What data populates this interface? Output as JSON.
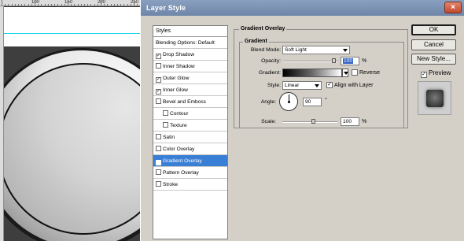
{
  "ruler": {
    "numbers": [
      "100",
      "150",
      "200",
      "250"
    ]
  },
  "dialog": {
    "title": "Layer Style",
    "close_glyph": "×"
  },
  "styles_panel": {
    "header": "Styles",
    "items": [
      {
        "label": "Blending Options: Default",
        "checkbox": false,
        "checked": false,
        "selected": false,
        "indent": false
      },
      {
        "label": "Drop Shadow",
        "checkbox": true,
        "checked": true,
        "selected": false,
        "indent": false
      },
      {
        "label": "Inner Shadow",
        "checkbox": true,
        "checked": false,
        "selected": false,
        "indent": false
      },
      {
        "label": "Outer Glow",
        "checkbox": true,
        "checked": true,
        "selected": false,
        "indent": false
      },
      {
        "label": "Inner Glow",
        "checkbox": true,
        "checked": true,
        "selected": false,
        "indent": false
      },
      {
        "label": "Bevel and Emboss",
        "checkbox": true,
        "checked": false,
        "selected": false,
        "indent": false
      },
      {
        "label": "Contour",
        "checkbox": true,
        "checked": false,
        "selected": false,
        "indent": true
      },
      {
        "label": "Texture",
        "checkbox": true,
        "checked": false,
        "selected": false,
        "indent": true
      },
      {
        "label": "Satin",
        "checkbox": true,
        "checked": false,
        "selected": false,
        "indent": false
      },
      {
        "label": "Color Overlay",
        "checkbox": true,
        "checked": false,
        "selected": false,
        "indent": false
      },
      {
        "label": "Gradient Overlay",
        "checkbox": true,
        "checked": true,
        "selected": true,
        "indent": false
      },
      {
        "label": "Pattern Overlay",
        "checkbox": true,
        "checked": false,
        "selected": false,
        "indent": false
      },
      {
        "label": "Stroke",
        "checkbox": true,
        "checked": false,
        "selected": false,
        "indent": false
      }
    ]
  },
  "gradient_overlay": {
    "section_title": "Gradient Overlay",
    "group_title": "Gradient",
    "blend_mode_label": "Blend Mode:",
    "blend_mode_value": "Soft Light",
    "opacity_label": "Opacity:",
    "opacity_value": "100",
    "opacity_unit": "%",
    "gradient_label": "Gradient:",
    "reverse_label": "Reverse",
    "reverse_checked": false,
    "style_label": "Style:",
    "style_value": "Linear",
    "align_label": "Align with Layer",
    "align_checked": true,
    "angle_label": "Angle:",
    "angle_value": "90",
    "angle_unit": "°",
    "scale_label": "Scale:",
    "scale_value": "100",
    "scale_unit": "%"
  },
  "buttons": {
    "ok": "OK",
    "cancel": "Cancel",
    "new_style": "New Style..."
  },
  "preview": {
    "label": "Preview",
    "checked": true
  },
  "colors": {
    "selection": "#3a7fd6",
    "titlebar": "#7a91b4",
    "close": "#c24a2f",
    "dialog_bg": "#d4d0c8"
  }
}
